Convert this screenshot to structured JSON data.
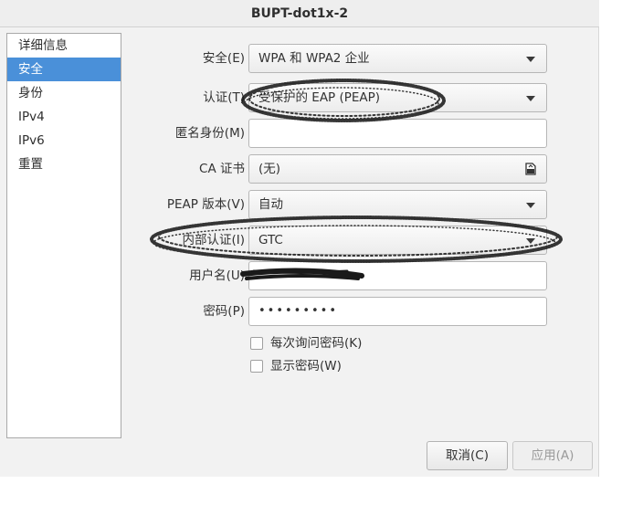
{
  "window": {
    "title": "BUPT-dot1x-2"
  },
  "sidebar": {
    "items": [
      {
        "label": "详细信息",
        "active": false
      },
      {
        "label": "安全",
        "active": true
      },
      {
        "label": "身份",
        "active": false
      },
      {
        "label": "IPv4",
        "active": false
      },
      {
        "label": "IPv6",
        "active": false
      },
      {
        "label": "重置",
        "active": false
      }
    ]
  },
  "form": {
    "security": {
      "label": "安全(E)",
      "value": "WPA 和 WPA2 企业"
    },
    "auth": {
      "label": "认证(T)",
      "value": "受保护的 EAP (PEAP)"
    },
    "anonymous": {
      "label": "匿名身份(M)",
      "value": ""
    },
    "ca_cert": {
      "label": "CA 证书",
      "value": "(无)"
    },
    "peap_version": {
      "label": "PEAP 版本(V)",
      "value": "自动"
    },
    "inner_auth": {
      "label": "内部认证(I)",
      "value": "GTC"
    },
    "username": {
      "label": "用户名(U)",
      "value": ""
    },
    "password": {
      "label": "密码(P)",
      "value": "•••••••••"
    },
    "ask_password": {
      "label": "每次询问密码(K)",
      "checked": false
    },
    "show_password": {
      "label": "显示密码(W)",
      "checked": false
    }
  },
  "buttons": {
    "cancel": "取消(C)",
    "apply": "应用(A)"
  },
  "icons": {
    "dropdown": "chevron-down-icon",
    "file": "file-picker-icon"
  },
  "colors": {
    "selection": "#4a90d9",
    "window_bg": "#f2f2f2",
    "annotation": "#111111"
  }
}
